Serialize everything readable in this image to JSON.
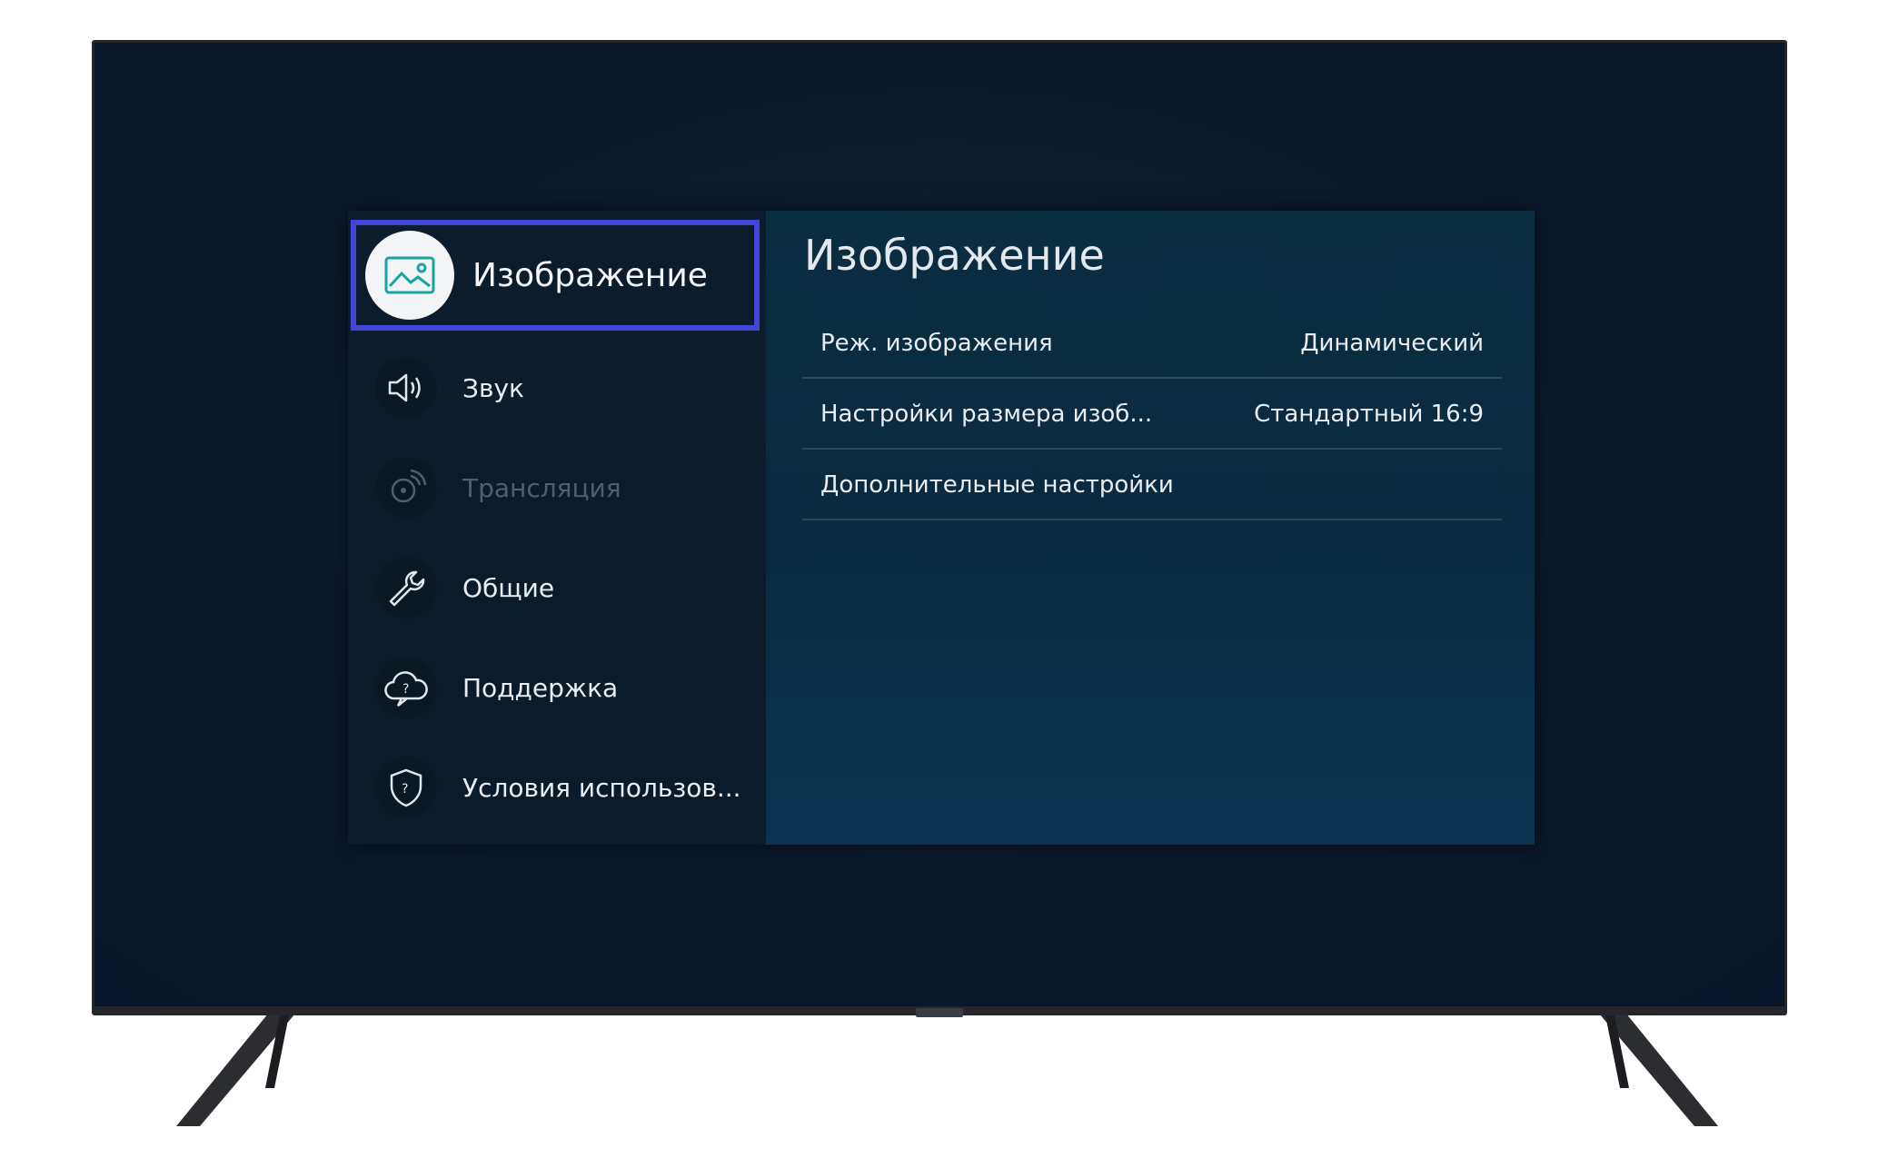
{
  "menu": {
    "sidebar": {
      "items": [
        {
          "label": "Изображение",
          "icon": "picture-icon",
          "state": "selected"
        },
        {
          "label": "Звук",
          "icon": "sound-icon",
          "state": "normal"
        },
        {
          "label": "Трансляция",
          "icon": "broadcast-icon",
          "state": "disabled"
        },
        {
          "label": "Общие",
          "icon": "wrench-icon",
          "state": "normal"
        },
        {
          "label": "Поддержка",
          "icon": "support-cloud-icon",
          "state": "normal"
        },
        {
          "label": "Условия использов...",
          "icon": "shield-icon",
          "state": "normal"
        }
      ]
    },
    "content": {
      "title": "Изображение",
      "rows": [
        {
          "label": "Реж. изображения",
          "value": "Динамический"
        },
        {
          "label": "Настройки размера изоб...",
          "value": "Стандартный 16:9"
        },
        {
          "label": "Дополнительные настройки",
          "value": ""
        }
      ]
    }
  },
  "colors": {
    "selection_border": "#3f46d8",
    "accent_icon": "#19a3a3"
  }
}
